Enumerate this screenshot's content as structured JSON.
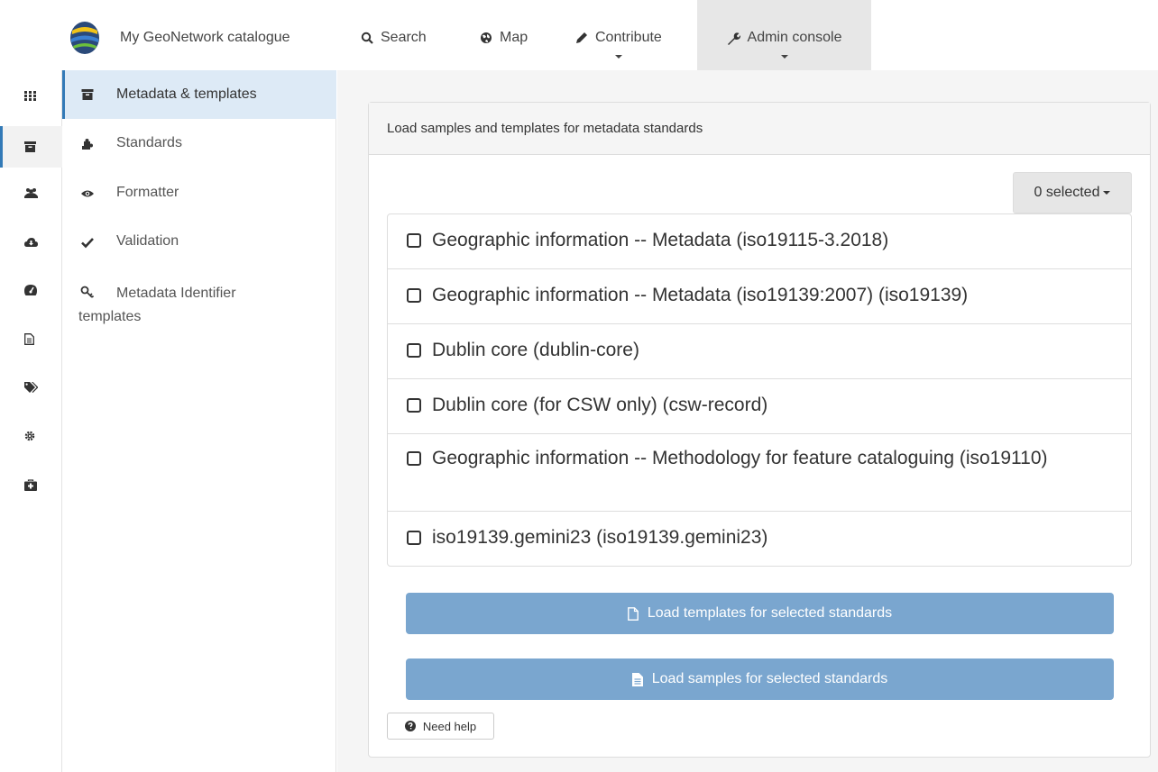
{
  "brand": {
    "title": "My GeoNetwork catalogue",
    "logo_icon": "geonetwork-globe-logo"
  },
  "topnav": {
    "search": "Search",
    "map": "Map",
    "contribute": "Contribute",
    "admin": "Admin console"
  },
  "rail": {
    "items": [
      {
        "icon": "grid-icon",
        "active": false
      },
      {
        "icon": "archive-icon",
        "active": true
      },
      {
        "icon": "users-icon",
        "active": false
      },
      {
        "icon": "cloud-download-icon",
        "active": false
      },
      {
        "icon": "dashboard-icon",
        "active": false
      },
      {
        "icon": "file-text-icon",
        "active": false
      },
      {
        "icon": "tags-icon",
        "active": false
      },
      {
        "icon": "gear-icon",
        "active": false
      },
      {
        "icon": "medkit-icon",
        "active": false
      }
    ]
  },
  "submenu": {
    "items": [
      {
        "label": "Metadata & templates",
        "icon": "archive-icon",
        "active": true
      },
      {
        "label": "Standards",
        "icon": "puzzle-icon"
      },
      {
        "label": "Formatter",
        "icon": "eye-icon"
      },
      {
        "label": "Validation",
        "icon": "check-icon"
      },
      {
        "label_line1": "Metadata Identifier",
        "label_line2": "templates",
        "icon": "key-icon"
      }
    ]
  },
  "panel": {
    "heading": "Load samples and templates for metadata standards",
    "selected_label": "0 selected",
    "standards": [
      "Geographic information -- Metadata (iso19115-3.2018)",
      "Geographic information -- Metadata (iso19139:2007) (iso19139)",
      "Dublin core (dublin-core)",
      "Dublin core (for CSW only) (csw-record)",
      "Geographic information -- Methodology for feature cataloguing (iso19110)",
      "iso19139.gemini23 (iso19139.gemini23)"
    ],
    "load_templates_label": "Load templates for selected standards",
    "load_samples_label": "Load samples for selected standards",
    "help_label": "Need help"
  },
  "colors": {
    "accent": "#337ab7",
    "button_disabled": "#7aa6cf",
    "admin_tab_bg": "#e7e7e7"
  }
}
